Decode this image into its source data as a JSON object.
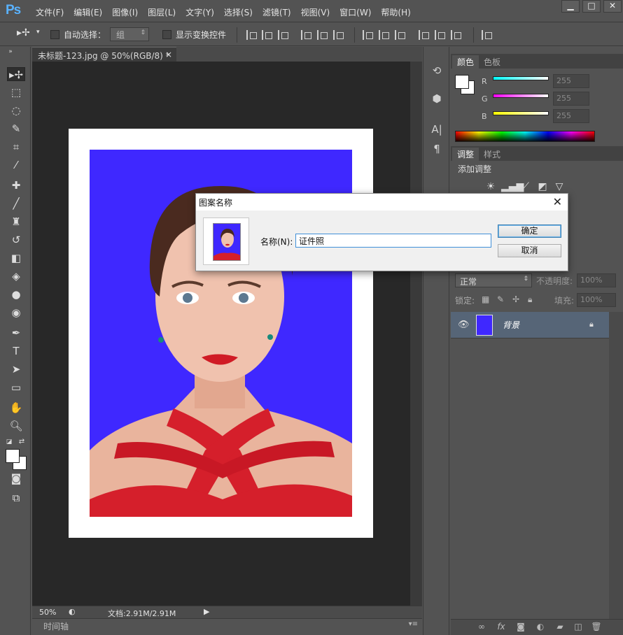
{
  "app": {
    "logo": "Ps"
  },
  "menu": {
    "items": [
      "文件(F)",
      "编辑(E)",
      "图像(I)",
      "图层(L)",
      "文字(Y)",
      "选择(S)",
      "滤镜(T)",
      "视图(V)",
      "窗口(W)",
      "帮助(H)"
    ]
  },
  "window_controls": {
    "minimize": "▁",
    "maximize": "□",
    "close": "✕"
  },
  "options": {
    "auto_select_label": "自动选择：",
    "auto_select_value": "组",
    "show_transform_label": "显示变换控件"
  },
  "document": {
    "tab_title": "未标题-123.jpg @ 50%(RGB/8) *",
    "tab_close": "×"
  },
  "status": {
    "zoom": "50%",
    "doc_size": "文档:2.91M/2.91M"
  },
  "timeline": {
    "label": "时间轴"
  },
  "color_panel": {
    "tabs": [
      "颜色",
      "色板"
    ],
    "channels": [
      {
        "label": "R",
        "value": "255",
        "color": "#00ffff"
      },
      {
        "label": "G",
        "value": "255",
        "color": "#ff00ff"
      },
      {
        "label": "B",
        "value": "255",
        "color": "#ffff00"
      }
    ]
  },
  "adjust_panel": {
    "tabs": [
      "调整",
      "样式"
    ],
    "title": "添加调整"
  },
  "layers_panel": {
    "blend_mode": "正常",
    "opacity_label": "不透明度:",
    "opacity_value": "100%",
    "lock_label": "锁定:",
    "fill_label": "填充:",
    "fill_value": "100%",
    "layer_name": "背景"
  },
  "dialog": {
    "title": "图案名称",
    "name_label": "名称(N):",
    "name_value": "证件照",
    "ok_label": "确定",
    "cancel_label": "取消"
  },
  "colors": {
    "photo_background": "#3f28ff",
    "dress": "#d51f2b",
    "selected_layer": "#566577"
  }
}
